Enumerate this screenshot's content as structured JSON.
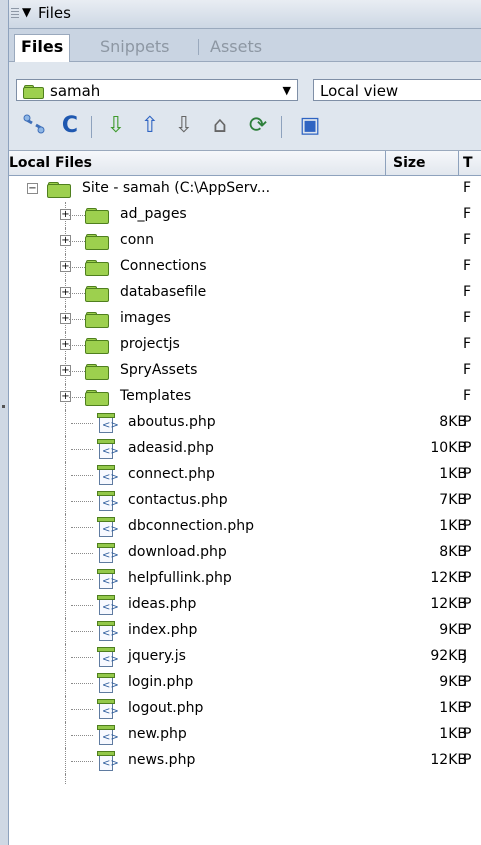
{
  "panel": {
    "title": "Files"
  },
  "tabs": [
    {
      "label": "Files"
    },
    {
      "label": "Snippets"
    },
    {
      "label": "Assets"
    }
  ],
  "site_select": {
    "value": "samah"
  },
  "view_select": {
    "value": "Local view"
  },
  "toolbar_icons": [
    "connect-icon",
    "refresh-icon",
    "get-icon",
    "put-icon",
    "checkout-icon",
    "checkin-icon",
    "synchronize-icon",
    "expand-icon"
  ],
  "columns": {
    "name": "Local Files",
    "size": "Size",
    "type": "T"
  },
  "tree": {
    "root": {
      "name": "Site - samah (C:\\AppServ...",
      "type": "F"
    },
    "folders": [
      {
        "name": "ad_pages",
        "type": "F"
      },
      {
        "name": "conn",
        "type": "F"
      },
      {
        "name": "Connections",
        "type": "F"
      },
      {
        "name": "databasefile",
        "type": "F"
      },
      {
        "name": "images",
        "type": "F"
      },
      {
        "name": "projectjs",
        "type": "F"
      },
      {
        "name": "SpryAssets",
        "type": "F"
      },
      {
        "name": "Templates",
        "type": "F"
      }
    ],
    "files": [
      {
        "name": "aboutus.php",
        "size": "8KB",
        "type": "P"
      },
      {
        "name": "adeasid.php",
        "size": "10KB",
        "type": "P"
      },
      {
        "name": "connect.php",
        "size": "1KB",
        "type": "P"
      },
      {
        "name": "contactus.php",
        "size": "7KB",
        "type": "P"
      },
      {
        "name": "dbconnection.php",
        "size": "1KB",
        "type": "P"
      },
      {
        "name": "download.php",
        "size": "8KB",
        "type": "P"
      },
      {
        "name": "helpfullink.php",
        "size": "12KB",
        "type": "P"
      },
      {
        "name": "ideas.php",
        "size": "12KB",
        "type": "P"
      },
      {
        "name": "index.php",
        "size": "9KB",
        "type": "P"
      },
      {
        "name": "jquery.js",
        "size": "92KB",
        "type": "J"
      },
      {
        "name": "login.php",
        "size": "9KB",
        "type": "P"
      },
      {
        "name": "logout.php",
        "size": "1KB",
        "type": "P"
      },
      {
        "name": "new.php",
        "size": "1KB",
        "type": "P"
      },
      {
        "name": "news.php",
        "size": "12KB",
        "type": "P"
      }
    ]
  }
}
